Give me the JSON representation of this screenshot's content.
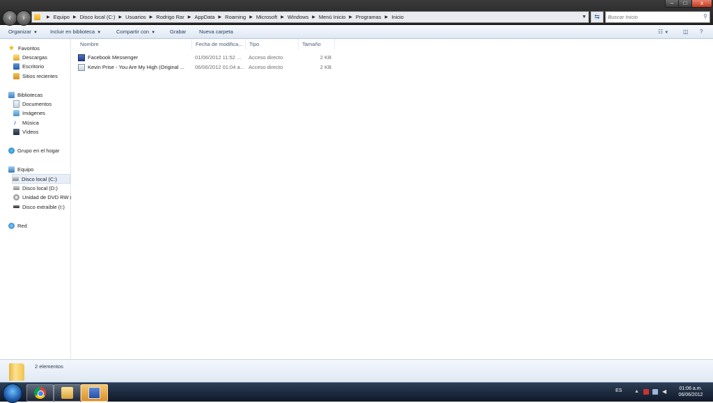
{
  "address_bar": {
    "crumbs": [
      "Equipo",
      "Disco local (C:)",
      "Usuarios",
      "Rodrigo Rar",
      "AppData",
      "Roaming",
      "Microsoft",
      "Windows",
      "Menú Inicio",
      "Programas",
      "Inicio"
    ]
  },
  "search": {
    "placeholder": "Buscar Inicio"
  },
  "window_controls": {
    "minimize": "–",
    "maximize": "□",
    "close": "x"
  },
  "toolbar": {
    "organize": "Organizar",
    "include_library": "Incluir en biblioteca",
    "share": "Compartir con",
    "burn": "Grabar",
    "new_folder": "Nueva carpeta"
  },
  "sidebar": {
    "favorites": "Favoritos",
    "downloads": "Descargas",
    "desktop": "Escritorio",
    "recent": "Sitios recientes",
    "libraries": "Bibliotecas",
    "documents": "Documentos",
    "images": "Imágenes",
    "music": "Música",
    "videos": "Vídeos",
    "homegroup": "Grupo en el hogar",
    "computer": "Equipo",
    "drive_c": "Disco local (C:)",
    "drive_d": "Disco local (D:)",
    "dvd": "Unidad de DVD RW (",
    "removable": "Disco extraíble (I:)",
    "network": "Red"
  },
  "columns": {
    "name": "Nombre",
    "date": "Fecha de modifica...",
    "type": "Tipo",
    "size": "Tamaño"
  },
  "files": [
    {
      "name": "Facebook Messenger",
      "date": "01/06/2012 11:52 ...",
      "type": "Acceso directo",
      "size": "2 KB"
    },
    {
      "name": "Kevin Prise - You Are My High (Original ...",
      "date": "06/06/2012 01:04 a...",
      "type": "Acceso directo",
      "size": "2 KB"
    }
  ],
  "details": {
    "count": "2 elementos"
  },
  "taskbar": {
    "lang": "ES",
    "time": "01:06 a.m.",
    "date": "06/06/2012"
  }
}
